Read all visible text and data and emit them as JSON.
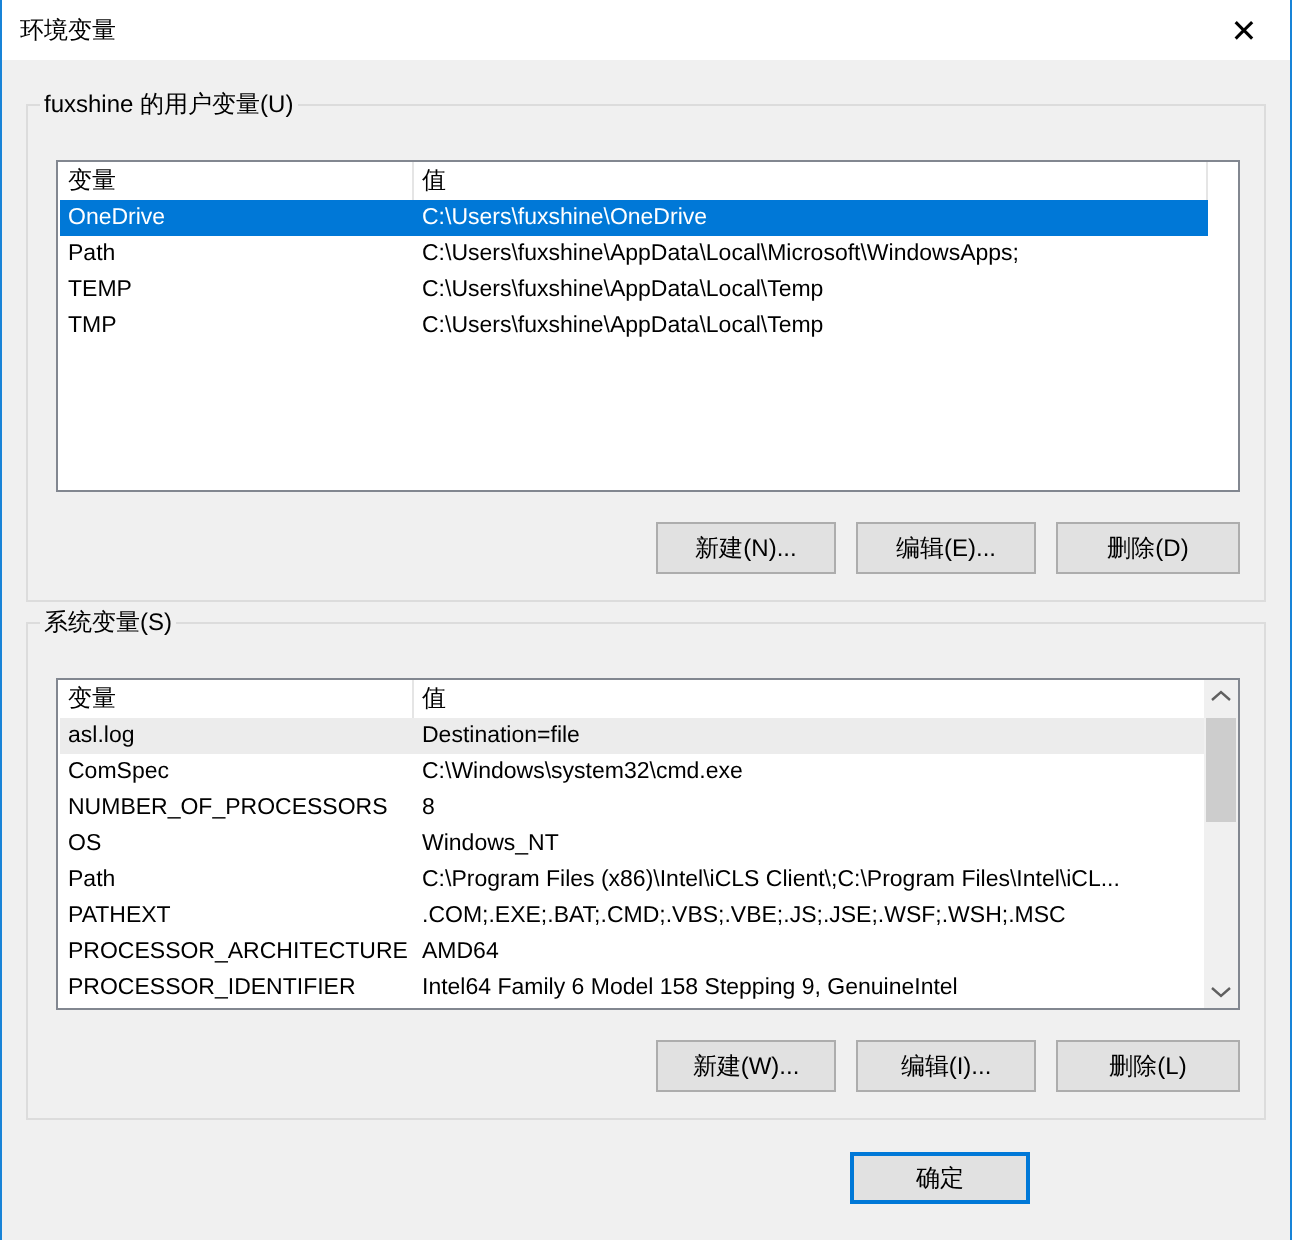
{
  "window": {
    "title": "环境变量",
    "close": "✕"
  },
  "groups": [
    {
      "title": "fuxshine 的用户变量(U)",
      "focused": true,
      "scrollbar": false,
      "columns": [
        "变量",
        "值"
      ],
      "rows": [
        {
          "name": "OneDrive",
          "value": "C:\\Users\\fuxshine\\OneDrive",
          "selected": true
        },
        {
          "name": "Path",
          "value": "C:\\Users\\fuxshine\\AppData\\Local\\Microsoft\\WindowsApps;",
          "selected": false
        },
        {
          "name": "TEMP",
          "value": "C:\\Users\\fuxshine\\AppData\\Local\\Temp",
          "selected": false
        },
        {
          "name": "TMP",
          "value": "C:\\Users\\fuxshine\\AppData\\Local\\Temp",
          "selected": false
        }
      ],
      "buttons": [
        "新建(N)...",
        "编辑(E)...",
        "删除(D)"
      ]
    },
    {
      "title": "系统变量(S)",
      "focused": false,
      "scrollbar": true,
      "columns": [
        "变量",
        "值"
      ],
      "rows": [
        {
          "name": "asl.log",
          "value": "Destination=file",
          "selected": true
        },
        {
          "name": "ComSpec",
          "value": "C:\\Windows\\system32\\cmd.exe",
          "selected": false
        },
        {
          "name": "NUMBER_OF_PROCESSORS",
          "value": "8",
          "selected": false
        },
        {
          "name": "OS",
          "value": "Windows_NT",
          "selected": false
        },
        {
          "name": "Path",
          "value": "C:\\Program Files (x86)\\Intel\\iCLS Client\\;C:\\Program Files\\Intel\\iCL...",
          "selected": false
        },
        {
          "name": "PATHEXT",
          "value": ".COM;.EXE;.BAT;.CMD;.VBS;.VBE;.JS;.JSE;.WSF;.WSH;.MSC",
          "selected": false
        },
        {
          "name": "PROCESSOR_ARCHITECTURE",
          "value": "AMD64",
          "selected": false
        },
        {
          "name": "PROCESSOR_IDENTIFIER",
          "value": "Intel64 Family 6 Model 158 Stepping 9, GenuineIntel",
          "selected": false
        }
      ],
      "buttons": [
        "新建(W)...",
        "编辑(I)...",
        "删除(L)"
      ]
    }
  ],
  "footer_buttons": [
    "确定"
  ]
}
